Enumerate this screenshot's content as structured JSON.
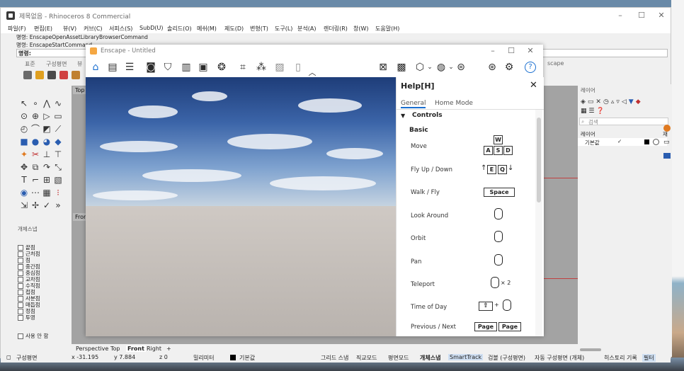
{
  "rhino": {
    "title": "제목없음 - Rhinoceros 8 Commercial",
    "menu": [
      "파일(F)",
      "편집(E)",
      "뷰(V)",
      "커브(C)",
      "서피스(S)",
      "SubD(U)",
      "솔리드(O)",
      "메쉬(M)",
      "제도(D)",
      "변형(T)",
      "도구(L)",
      "분석(A)",
      "렌더링(R)",
      "창(W)",
      "도움말(H)"
    ],
    "command_history": [
      "명령: EnscapeOpenAssetLibraryBrowserCommand",
      "명령: EnscapeStartCommand"
    ],
    "command_prompt": "명령:",
    "toolbar_tabs": [
      "표준",
      "구성평면",
      "뷰"
    ],
    "right_tab_fragment": "scape",
    "viewport_labels": {
      "top": "Top",
      "front": "Front"
    },
    "viewport_tabs": [
      "Perspective",
      "Top",
      "Front",
      "Right",
      "+"
    ],
    "osnap": {
      "title": "개체스냅",
      "items": [
        "끝점",
        "근처점",
        "점",
        "중간점",
        "중심점",
        "교차점",
        "수직점",
        "접점",
        "사분점",
        "매듭점",
        "정점",
        "투영"
      ],
      "disable": "사용 안 함"
    },
    "layers": {
      "title": "레이어",
      "search_placeholder": "검색",
      "column_header": "레이어",
      "column_header_2": "재",
      "default_layer": "기본값",
      "check": "✓"
    },
    "statusbar": {
      "cplane": "구성평면",
      "x": "x -31.195",
      "y": "y 7.884",
      "z": "z 0",
      "units": "밀리미터",
      "layer": "기본값",
      "toggles": [
        "그리드 스냅",
        "직교모드",
        "평면모드",
        "개체스냅",
        "SmartTrack",
        "검볼 (구성평면)",
        "자동 구성평면 (개체)",
        "히스토리 기록",
        "필터"
      ]
    }
  },
  "enscape": {
    "title": "Enscape - Untitled",
    "help": {
      "title": "Help[H]",
      "tabs": [
        "General",
        "Home Mode"
      ],
      "section": "Controls",
      "subsection": "Basic",
      "rows": [
        {
          "label": "Move",
          "keys": [
            "W",
            "A",
            "S",
            "D"
          ]
        },
        {
          "label": "Fly Up / Down",
          "keys": [
            "E",
            "Q"
          ]
        },
        {
          "label": "Walk / Fly",
          "keys": [
            "Space"
          ]
        },
        {
          "label": "Look Around",
          "mouse": "right-drag"
        },
        {
          "label": "Orbit",
          "mouse": "left-drag"
        },
        {
          "label": "Pan",
          "mouse": "middle-drag"
        },
        {
          "label": "Teleport",
          "mouse": "double-click",
          "suffix": "× 2"
        },
        {
          "label": "Time of Day",
          "keys": [
            "shift"
          ],
          "mouse": "right-drag"
        },
        {
          "label": "Previous / Next",
          "keys": [
            "Page",
            "Page"
          ]
        }
      ]
    }
  },
  "colors": {
    "enscape_accent": "#1a6fd0",
    "sky_top": "#1e3d79",
    "ground": "#c9c3be"
  }
}
